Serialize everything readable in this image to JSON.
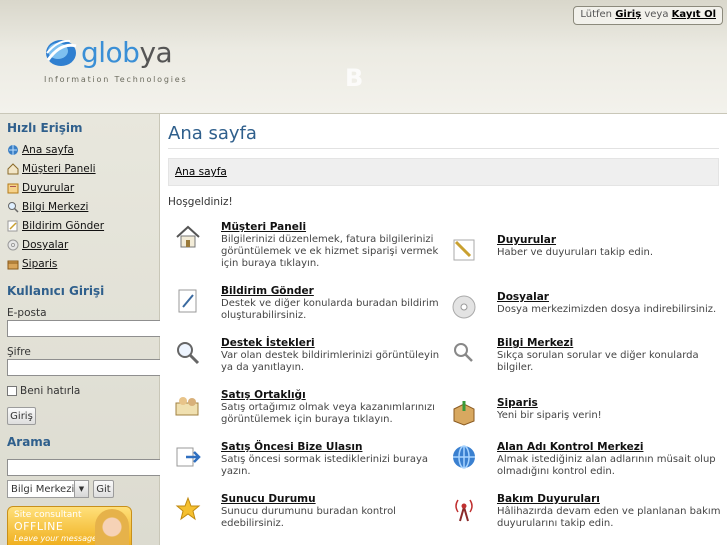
{
  "header": {
    "logo_text_a": "glob",
    "logo_text_b": "ya",
    "logo_tagline": "Information Technologies",
    "login_prefix": "Lütfen",
    "login_link": "Giriş",
    "login_mid": "veya",
    "register_link": "Kayıt Ol"
  },
  "sidebar": {
    "quick_title": "Hızlı Erişim",
    "items": [
      {
        "label": "Ana sayfa",
        "icon": "home-globe-icon"
      },
      {
        "label": "Müşteri Paneli",
        "icon": "house-icon"
      },
      {
        "label": "Duyurular",
        "icon": "announcement-icon"
      },
      {
        "label": "Bilgi Merkezi",
        "icon": "magnifier-icon"
      },
      {
        "label": "Bildirim Gönder",
        "icon": "pen-icon"
      },
      {
        "label": "Dosyalar",
        "icon": "disc-icon"
      },
      {
        "label": "Siparis",
        "icon": "box-icon"
      }
    ],
    "login_title": "Kullanıcı Girişi",
    "email_label": "E-posta",
    "password_label": "Şifre",
    "remember_label": "Beni hatırla",
    "login_button": "Giriş",
    "search_title": "Arama",
    "search_select_value": "Bilgi Merkezi",
    "search_button": "Git",
    "support": {
      "line1": "Site consultant",
      "line2": "OFFLINE",
      "line3": "Leave your message"
    }
  },
  "main": {
    "title": "Ana sayfa",
    "breadcrumb": "Ana sayfa",
    "welcome": "Hoşgeldiniz!",
    "tiles": [
      {
        "name": "Müşteri Paneli",
        "desc": "Bilgilerinizi düzenlemek, fatura bilgilerinizi görüntülemek ve ek hizmet siparişi vermek için buraya tıklayın.",
        "icon": "house-icon"
      },
      {
        "name": "Duyurular",
        "desc": "Haber ve duyuruları takip edin.",
        "icon": "announcement-icon"
      },
      {
        "name": "Bildirim Gönder",
        "desc": "Destek ve diğer konularda buradan bildirim oluşturabilirsiniz.",
        "icon": "pen-icon"
      },
      {
        "name": "Dosyalar",
        "desc": "Dosya merkezimizden dosya indirebilirsiniz.",
        "icon": "disc-icon"
      },
      {
        "name": "Destek İstekleri",
        "desc": "Var olan destek bildirimlerinizi görüntüleyin ya da yanıtlayın.",
        "icon": "search-icon"
      },
      {
        "name": "Bilgi Merkezi",
        "desc": "Sıkça sorulan sorular ve diğer konularda bilgiler.",
        "icon": "magnifier-icon"
      },
      {
        "name": "Satış Ortaklığı",
        "desc": "Satış ortağımız olmak veya kazanımlarınızı görüntülemek için buraya tıklayın.",
        "icon": "partners-icon"
      },
      {
        "name": "Siparis",
        "desc": "Yeni bir sipariş verin!",
        "icon": "box-icon"
      },
      {
        "name": "Satış Öncesi Bize Ulasın",
        "desc": "Satış öncesi sormak istediklerinizi buraya yazın.",
        "icon": "arrow-icon"
      },
      {
        "name": "Alan Adı Kontrol Merkezi",
        "desc": "Almak istediğiniz alan adlarının müsait olup olmadığını kontrol edin.",
        "icon": "globe-icon"
      },
      {
        "name": "Sunucu Durumu",
        "desc": "Sunucu durumunu buradan kontrol edebilirsiniz.",
        "icon": "star-icon"
      },
      {
        "name": "Bakım Duyuruları",
        "desc": "Hâlihazırda devam eden ve planlanan bakım duyurularını takip edin.",
        "icon": "antenna-icon"
      }
    ]
  }
}
